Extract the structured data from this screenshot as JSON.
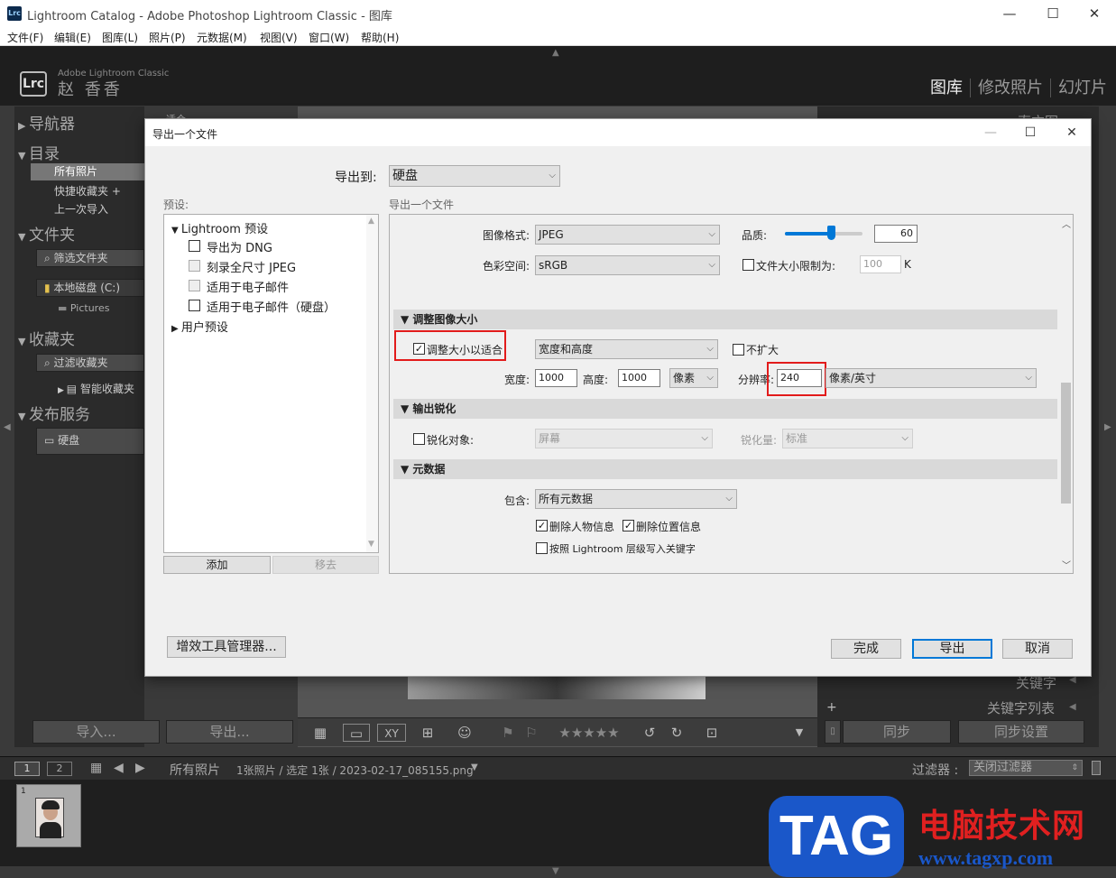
{
  "window": {
    "title": "Lightroom Catalog - Adobe Photoshop Lightroom Classic - 图库",
    "icon": "Lrc",
    "controls": {
      "min": "—",
      "max": "☐",
      "close": "✕"
    }
  },
  "menu": [
    "文件(F)",
    "编辑(E)",
    "图库(L)",
    "照片(P)",
    "元数据(M)",
    "视图(V)",
    "窗口(W)",
    "帮助(H)"
  ],
  "lr": {
    "logo": "Lrc",
    "brand": "Adobe Lightroom Classic",
    "user": "赵 香香",
    "modules": [
      "图库",
      "修改照片",
      "幻灯片"
    ]
  },
  "left_panel": {
    "navigator": "导航器",
    "catalog": "目录",
    "catalog_items": [
      "所有照片",
      "快捷收藏夹 +",
      "上一次导入"
    ],
    "folders": "文件夹",
    "filter_folders": "筛选文件夹",
    "disk": "本地磁盘 (C:)",
    "pictures": "Pictures",
    "collections": "收藏夹",
    "filter_collections": "过滤收藏夹",
    "smart": "智能收藏夹",
    "publish": "发布服务",
    "hdd": "硬盘",
    "import_btn": "导入...",
    "export_btn": "导出..."
  },
  "right_panel": {
    "top_label": "直方图",
    "keyword": "关键字",
    "keyword_list": "关键字列表",
    "sync": "同步",
    "sync_settings": "同步设置"
  },
  "center": {
    "fit_label": "适合"
  },
  "filmstrip": {
    "page1": "1",
    "page2": "2",
    "source": "所有照片",
    "info": "1张照片 / 选定 1张 / 2023-02-17_085155.png",
    "filter_label": "过滤器 :",
    "filter_value": "关闭过滤器",
    "thumb_number": "1"
  },
  "watermark": {
    "tag": "TAG",
    "cn": "电脑技术网",
    "url": "www.tagxp.com"
  },
  "dialog": {
    "title": "导出一个文件",
    "export_to_label": "导出到:",
    "export_to_value": "硬盘",
    "presets_label": "预设:",
    "presets_root": "Lightroom 预设",
    "presets": [
      "导出为 DNG",
      "刻录全尺寸 JPEG",
      "适用于电子邮件",
      "适用于电子邮件（硬盘）"
    ],
    "user_presets": "用户预设",
    "add_btn": "添加",
    "remove_btn": "移去",
    "plugin_btn": "增效工具管理器...",
    "settings_label": "导出一个文件",
    "image_format_label": "图像格式:",
    "image_format_value": "JPEG",
    "quality_label": "品质:",
    "quality_value": "60",
    "quality_fraction": 0.6,
    "color_space_label": "色彩空间:",
    "color_space_value": "sRGB",
    "limit_size_label": "文件大小限制为:",
    "limit_size_value": "100",
    "limit_size_unit": "K",
    "resize_section": "调整图像大小",
    "resize_to_fit": "调整大小以适合",
    "resize_mode": "宽度和高度",
    "dont_enlarge": "不扩大",
    "width_label": "宽度:",
    "width_value": "1000",
    "height_label": "高度:",
    "height_value": "1000",
    "unit": "像素",
    "resolution_label": "分辨率:",
    "resolution_value": "240",
    "resolution_unit": "像素/英寸",
    "sharpen_section": "输出锐化",
    "sharpen_for": "锐化对象:",
    "sharpen_for_value": "屏幕",
    "sharpen_amount_label": "锐化量:",
    "sharpen_amount_value": "标准",
    "metadata_section": "元数据",
    "include_label": "包含:",
    "include_value": "所有元数据",
    "remove_person": "删除人物信息",
    "remove_location": "删除位置信息",
    "hierarchy_keywords": "按照 Lightroom 层级写入关键字",
    "done_btn": "完成",
    "export_btn": "导出",
    "cancel_btn": "取消"
  },
  "colors": {
    "highlight_red": "#e21b1b",
    "primary_border": "#0078d7",
    "lr_dark": "#2b2b2b"
  }
}
